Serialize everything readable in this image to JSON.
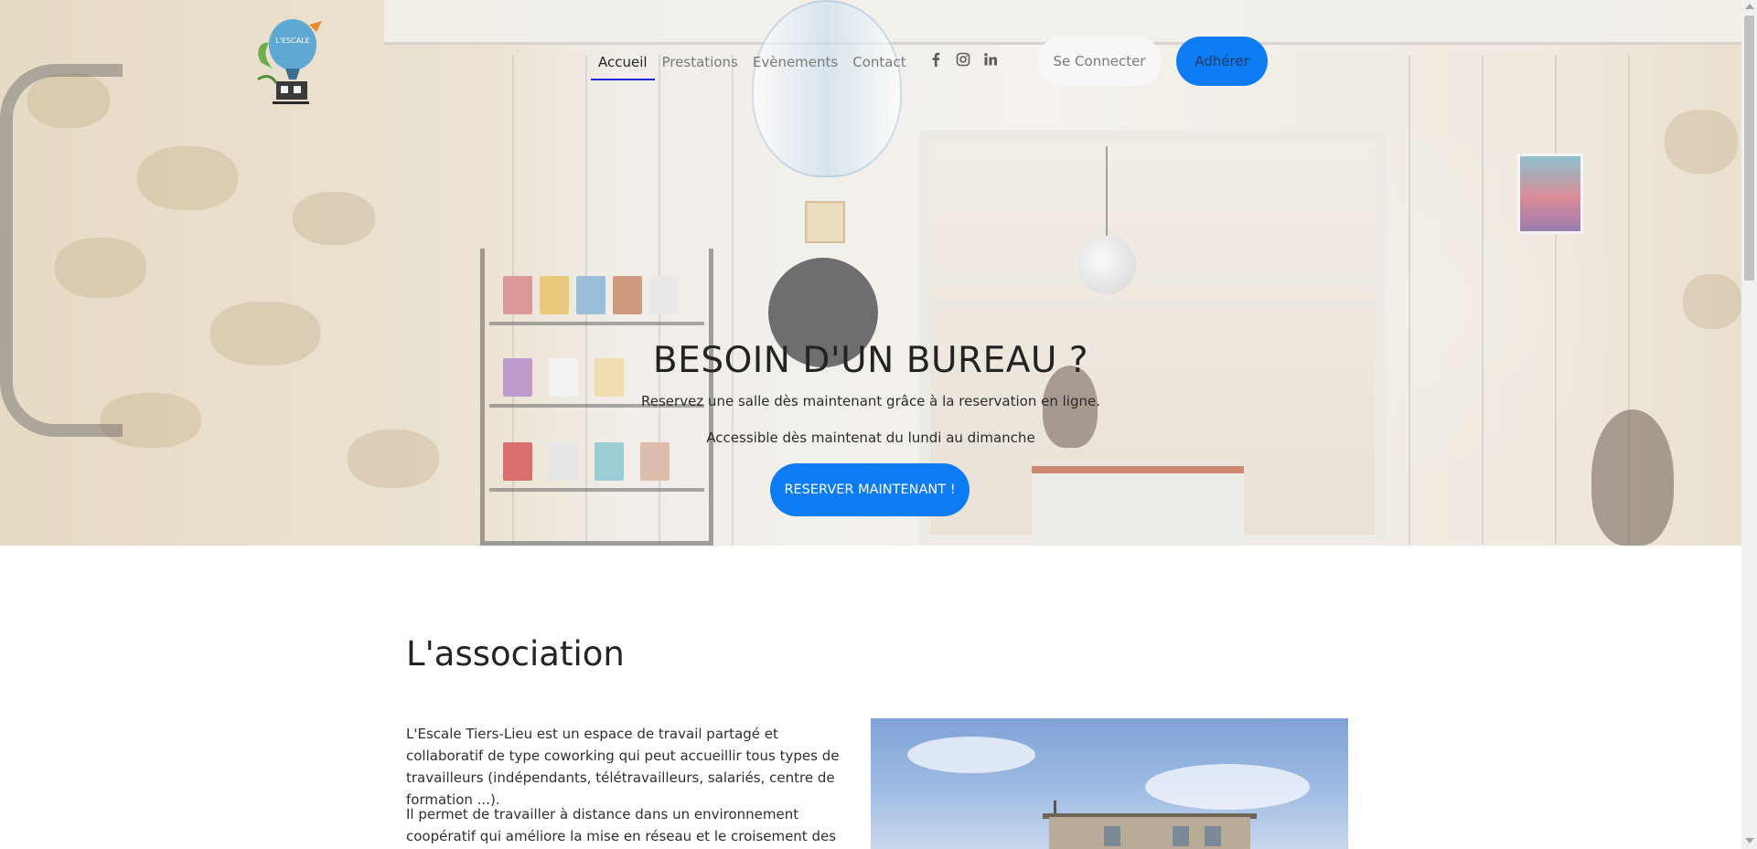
{
  "nav": {
    "logo_text": "L'ESCALE",
    "items": [
      {
        "label": "Accueil",
        "active": true
      },
      {
        "label": "Prestations",
        "active": false
      },
      {
        "label": "Evènements",
        "active": false
      },
      {
        "label": "Contact",
        "active": false
      }
    ],
    "social": [
      "facebook-icon",
      "instagram-icon",
      "linkedin-icon"
    ],
    "login_label": "Se Connecter",
    "join_label": "Adhérer"
  },
  "hero": {
    "title": "BESOIN D'UN BUREAU ?",
    "subtitle1": "Reservez une salle dès maintenant grâce à la reservation en ligne.",
    "subtitle2": "Accessible dès maintenat du lundi au dimanche",
    "cta_label": "RESERVER MAINTENANT !"
  },
  "association": {
    "title": "L'association",
    "p1": "L'Escale Tiers-Lieu est un espace de travail partagé et collaboratif de type coworking qui peut accueillir tous types de travailleurs (indépendants, télétravailleurs, salariés, centre de formation ...).",
    "p2": "Il permet de travailler à distance dans un environnement coopératif qui améliore la mise en réseau et le croisement des"
  },
  "colors": {
    "accent": "#0d7cf2",
    "active_underline": "#1e28d7"
  }
}
